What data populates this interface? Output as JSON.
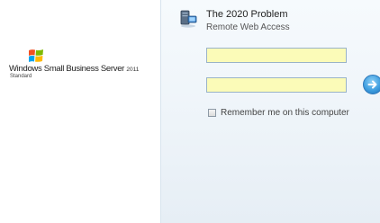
{
  "branding": {
    "product": "Windows Small Business Server",
    "year": "2011",
    "edition": "Standard"
  },
  "header": {
    "title": "The 2020 Problem",
    "subtitle": "Remote Web Access"
  },
  "form": {
    "username_value": "",
    "password_value": "",
    "remember_label": "Remember me on this computer"
  },
  "icons": {
    "server": "server-icon",
    "submit": "arrow-right-circle-icon",
    "logo": "windows-flag-icon"
  },
  "colors": {
    "field_bg": "#fbfbb8",
    "accent": "#3f9fe0"
  }
}
